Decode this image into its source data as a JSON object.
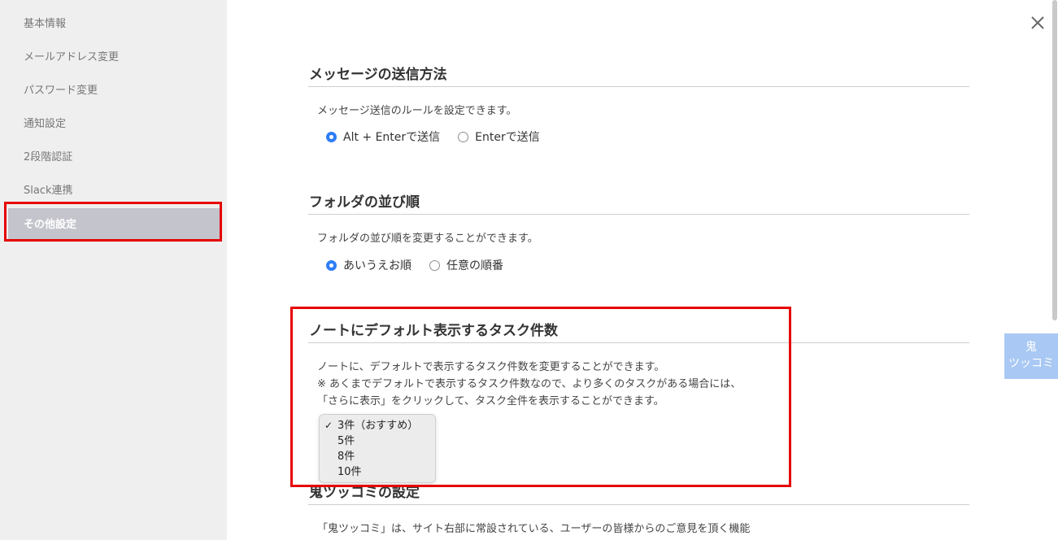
{
  "sidebar": {
    "items": [
      {
        "label": "基本情報"
      },
      {
        "label": "メールアドレス変更"
      },
      {
        "label": "パスワード変更"
      },
      {
        "label": "通知設定"
      },
      {
        "label": "2段階認証"
      },
      {
        "label": "Slack連携"
      },
      {
        "label": "その他設定"
      }
    ]
  },
  "send_method": {
    "title": "メッセージの送信方法",
    "description": "メッセージ送信のルールを設定できます。",
    "options": [
      {
        "label": "Alt + Enterで送信",
        "checked": true
      },
      {
        "label": "Enterで送信",
        "checked": false
      }
    ]
  },
  "folder_order": {
    "title": "フォルダの並び順",
    "description": "フォルダの並び順を変更することができます。",
    "options": [
      {
        "label": "あいうえお順",
        "checked": true
      },
      {
        "label": "任意の順番",
        "checked": false
      }
    ]
  },
  "task_count": {
    "title": "ノートにデフォルト表示するタスク件数",
    "description_lines": [
      "ノートに、デフォルトで表示するタスク件数を変更することができます。",
      "※ あくまでデフォルトで表示するタスク件数なので、より多くのタスクがある場合には、",
      "「さらに表示」をクリックして、タスク全件を表示することができます。"
    ],
    "dropdown": {
      "check_glyph": "✓",
      "options": [
        {
          "label": "3件（おすすめ）",
          "selected": true
        },
        {
          "label": "5件",
          "selected": false
        },
        {
          "label": "8件",
          "selected": false
        },
        {
          "label": "10件",
          "selected": false
        }
      ]
    }
  },
  "oni": {
    "title": "鬼ツッコミの設定",
    "description": "「鬼ツッコミ」は、サイト右部に常設されている、ユーザーの皆様からのご意見を頂く機能",
    "button_line1": "鬼",
    "button_line2": "ツッコミ"
  },
  "colors": {
    "accent": "#2f7df6",
    "highlight": "#e60000",
    "sidebar_active": "#c4c4cc",
    "oni_button": "#a9c9f4"
  },
  "icons": {
    "close": "close-icon"
  }
}
